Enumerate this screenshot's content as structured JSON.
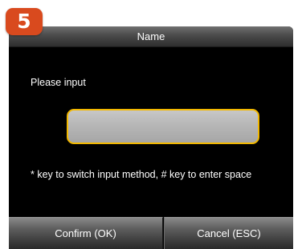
{
  "step_badge": "5",
  "dialog": {
    "title": "Name",
    "prompt": "Please input",
    "input": {
      "value": "",
      "placeholder": ""
    },
    "hint": "* key to switch input method, # key to enter space"
  },
  "soft_keys": {
    "confirm_label": "Confirm (OK)",
    "cancel_label": "Cancel (ESC)"
  },
  "colors": {
    "badge": "#d94a1e",
    "input_border": "#f2b800",
    "screen_background": "#000000"
  }
}
